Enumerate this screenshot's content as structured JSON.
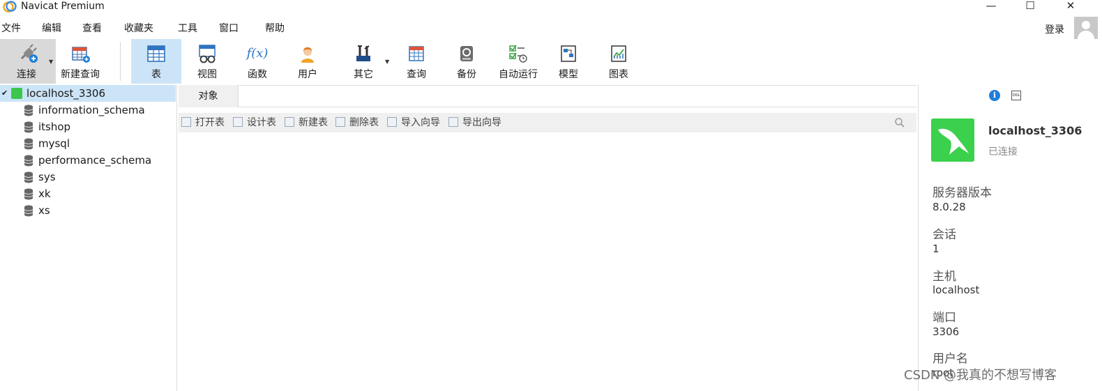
{
  "window": {
    "title": "Navicat Premium",
    "controls": {
      "minimize": "—",
      "maximize": "☐",
      "close": "✕"
    }
  },
  "menu": {
    "items": [
      "文件",
      "编辑",
      "查看",
      "收藏夹",
      "工具",
      "窗口",
      "帮助"
    ],
    "login": "登录"
  },
  "toolbar": {
    "buttons": [
      {
        "label": "连接",
        "icon": "plug-connect-icon"
      },
      {
        "label": "新建查询",
        "icon": "new-query-icon"
      },
      {
        "label": "表",
        "icon": "table-icon"
      },
      {
        "label": "视图",
        "icon": "view-glasses-icon"
      },
      {
        "label": "函数",
        "icon": "function-fx-icon"
      },
      {
        "label": "用户",
        "icon": "user-icon"
      },
      {
        "label": "其它",
        "icon": "tools-icon"
      },
      {
        "label": "查询",
        "icon": "query-icon"
      },
      {
        "label": "备份",
        "icon": "backup-icon"
      },
      {
        "label": "自动运行",
        "icon": "automation-icon"
      },
      {
        "label": "模型",
        "icon": "model-icon"
      },
      {
        "label": "图表",
        "icon": "chart-icon"
      }
    ],
    "fx_glyph": "f(x)"
  },
  "tree": {
    "connection": "localhost_3306",
    "databases": [
      "information_schema",
      "itshop",
      "mysql",
      "performance_schema",
      "sys",
      "xk",
      "xs"
    ]
  },
  "center": {
    "tab": "对象",
    "actions": [
      "打开表",
      "设计表",
      "新建表",
      "删除表",
      "导入向导",
      "导出向导"
    ]
  },
  "info": {
    "tab_info_glyph": "i",
    "tab_ddl_glyph": "DDL",
    "name": "localhost_3306",
    "status": "已连接",
    "fields": [
      {
        "label": "服务器版本",
        "value": "8.0.28"
      },
      {
        "label": "会话",
        "value": "1"
      },
      {
        "label": "主机",
        "value": "localhost"
      },
      {
        "label": "端口",
        "value": "3306"
      },
      {
        "label": "用户名",
        "value": "root"
      }
    ]
  },
  "watermark": "CSDN @我真的不想写博客",
  "colors": {
    "selection": "#cce4f7",
    "brand_green": "#3bd14c",
    "info_blue": "#1e7fd8"
  }
}
